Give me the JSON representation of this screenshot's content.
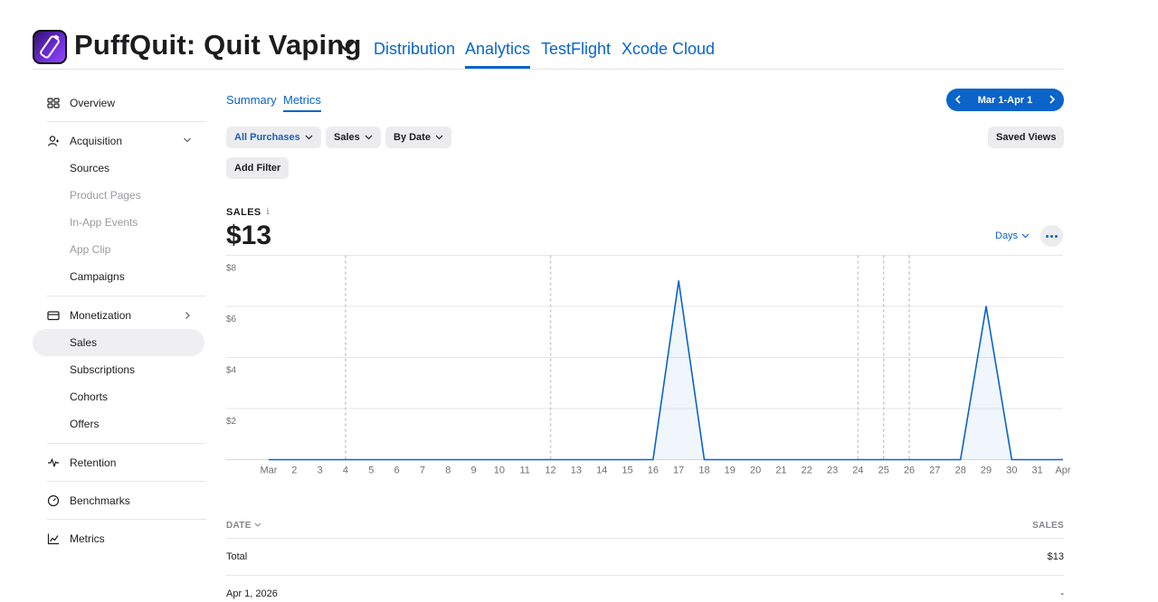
{
  "app": {
    "name": "PuffQuit: Quit Vaping"
  },
  "top_nav": [
    {
      "label": "Distribution",
      "active": false
    },
    {
      "label": "Analytics",
      "active": true
    },
    {
      "label": "TestFlight",
      "active": false
    },
    {
      "label": "Xcode Cloud",
      "active": false
    }
  ],
  "sidebar": {
    "overview": "Overview",
    "acquisition": "Acquisition",
    "acquisition_items": [
      {
        "label": "Sources",
        "enabled": true
      },
      {
        "label": "Product Pages",
        "enabled": false
      },
      {
        "label": "In-App Events",
        "enabled": false
      },
      {
        "label": "App Clip",
        "enabled": false
      },
      {
        "label": "Campaigns",
        "enabled": true
      }
    ],
    "monetization": "Monetization",
    "monetization_items": [
      {
        "label": "Sales",
        "selected": true
      },
      {
        "label": "Subscriptions",
        "selected": false
      },
      {
        "label": "Cohorts",
        "selected": false
      },
      {
        "label": "Offers",
        "selected": false
      }
    ],
    "retention": "Retention",
    "benchmarks": "Benchmarks",
    "metrics": "Metrics"
  },
  "subtabs": [
    {
      "label": "Summary",
      "active": false
    },
    {
      "label": "Metrics",
      "active": true
    }
  ],
  "date_range": "Mar 1-Apr 1",
  "filters": {
    "purchases": "All Purchases",
    "measure": "Sales",
    "group": "By Date",
    "add_filter": "Add Filter",
    "saved_views": "Saved Views"
  },
  "metric": {
    "label": "SALES",
    "value": "$13"
  },
  "granularity": "Days",
  "chart_data": {
    "type": "area",
    "x": [
      "Mar",
      "2",
      "3",
      "4",
      "5",
      "6",
      "7",
      "8",
      "9",
      "10",
      "11",
      "12",
      "13",
      "14",
      "15",
      "16",
      "17",
      "18",
      "19",
      "20",
      "21",
      "22",
      "23",
      "24",
      "25",
      "26",
      "27",
      "28",
      "29",
      "30",
      "31",
      "Apr"
    ],
    "series": [
      {
        "values": [
          0,
          0,
          0,
          0,
          0,
          0,
          0,
          0,
          0,
          0,
          0,
          0,
          0,
          0,
          0,
          0,
          7,
          0,
          0,
          0,
          0,
          0,
          0,
          0,
          0,
          0,
          0,
          0,
          6,
          0,
          0,
          0
        ]
      }
    ],
    "ylim": [
      0,
      8
    ],
    "yticks": [
      "$2",
      "$4",
      "$6",
      "$8"
    ],
    "ytick_values": [
      2,
      4,
      6,
      8
    ],
    "dashed_marker_indices": [
      3,
      11,
      23,
      24,
      25
    ],
    "color": "#0a64c9",
    "grid": true
  },
  "table": {
    "headers": {
      "date": "DATE",
      "sales": "SALES"
    },
    "rows": [
      {
        "date": "Total",
        "sales": "$13"
      },
      {
        "date": "Apr 1, 2026",
        "sales": "-"
      }
    ]
  }
}
